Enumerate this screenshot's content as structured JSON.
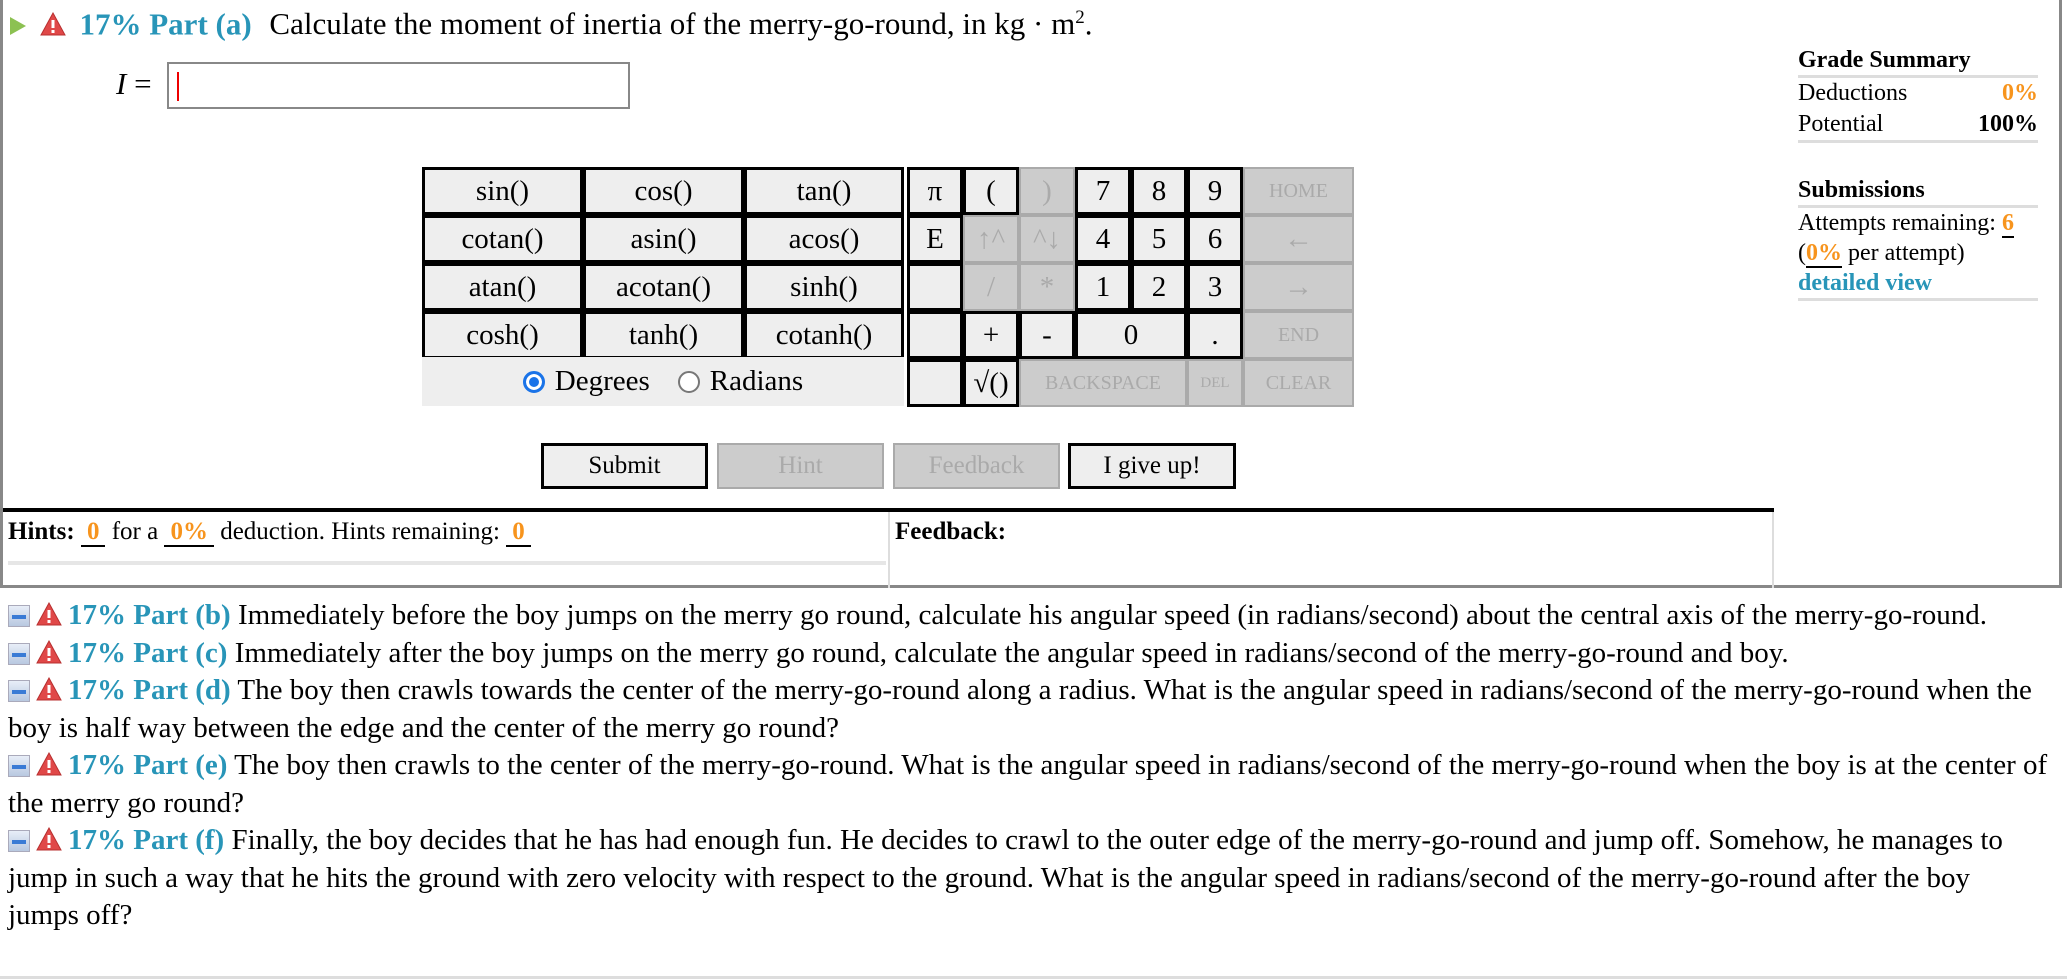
{
  "part_a": {
    "percent_label": "17% Part (a)",
    "question": "Calculate the moment of inertia of the merry-go-round, in kg · m",
    "question_sup": "2",
    "question_end": ".",
    "answer_label": "I",
    "answer_eq": " =",
    "answer_value": ""
  },
  "calculator": {
    "functions": [
      [
        "sin()",
        "cos()",
        "tan()"
      ],
      [
        "cotan()",
        "asin()",
        "acos()"
      ],
      [
        "atan()",
        "acotan()",
        "sinh()"
      ],
      [
        "cosh()",
        "tanh()",
        "cotanh()"
      ]
    ],
    "angle_mode": {
      "degrees": "Degrees",
      "radians": "Radians",
      "selected": "Degrees"
    },
    "keys": {
      "pi": "π",
      "lparen": "(",
      "rparen": ")",
      "e": "E",
      "up_caret": "↑^",
      "caret_down": "^↓",
      "divide": "/",
      "multiply": "*",
      "plus": "+",
      "minus": "-",
      "sqrt": "√()",
      "d7": "7",
      "d8": "8",
      "d9": "9",
      "d4": "4",
      "d5": "5",
      "d6": "6",
      "d1": "1",
      "d2": "2",
      "d3": "3",
      "d0": "0",
      "dot": ".",
      "home": "HOME",
      "left": "←",
      "right": "→",
      "end": "END",
      "backspace": "BACKSPACE",
      "del": "DEL",
      "clear": "CLEAR"
    }
  },
  "actions": {
    "submit": "Submit",
    "hint": "Hint",
    "feedback": "Feedback",
    "give_up": "I give up!"
  },
  "hints": {
    "label": "Hints:",
    "count": "0",
    "for_a": "for a",
    "deduction": "0%",
    "deduction_text": "deduction. Hints remaining:",
    "remaining": "0"
  },
  "feedback": {
    "label": "Feedback:"
  },
  "grade_summary": {
    "title": "Grade Summary",
    "deductions_label": "Deductions",
    "deductions_value": "0%",
    "potential_label": "Potential",
    "potential_value": "100%",
    "submissions_title": "Submissions",
    "attempts_label": "Attempts remaining:",
    "attempts_value": "6",
    "per_attempt_open": "(",
    "per_attempt_value": "0%",
    "per_attempt_text": "per attempt)",
    "detailed_view": "detailed view"
  },
  "parts": [
    {
      "label": "17% Part (b)",
      "text": "Immediately before the boy jumps on the merry go round, calculate his angular speed (in radians/second) about the central axis of the merry-go-round."
    },
    {
      "label": "17% Part (c)",
      "text": "Immediately after the boy jumps on the merry go round, calculate the angular speed in radians/second of the merry-go-round and boy."
    },
    {
      "label": "17% Part (d)",
      "text": "The boy then crawls towards the center of the merry-go-round along a radius. What is the angular speed in radians/second of the merry-go-round when the boy is half way between the edge and the center of the merry go round?"
    },
    {
      "label": "17% Part (e)",
      "text": "The boy then crawls to the center of the merry-go-round. What is the angular speed in radians/second of the merry-go-round when the boy is at the center of the merry go round?"
    },
    {
      "label": "17% Part (f)",
      "text": "Finally, the boy decides that he has had enough fun. He decides to crawl to the outer edge of the merry-go-round and jump off. Somehow, he manages to jump in such a way that he hits the ground with zero velocity with respect to the ground. What is the angular speed in radians/second of the merry-go-round after the boy jumps off?"
    }
  ],
  "colors": {
    "accent": "#2895b8",
    "orange": "#f7941d",
    "warn": "#e04848",
    "play": "#8cc152"
  }
}
